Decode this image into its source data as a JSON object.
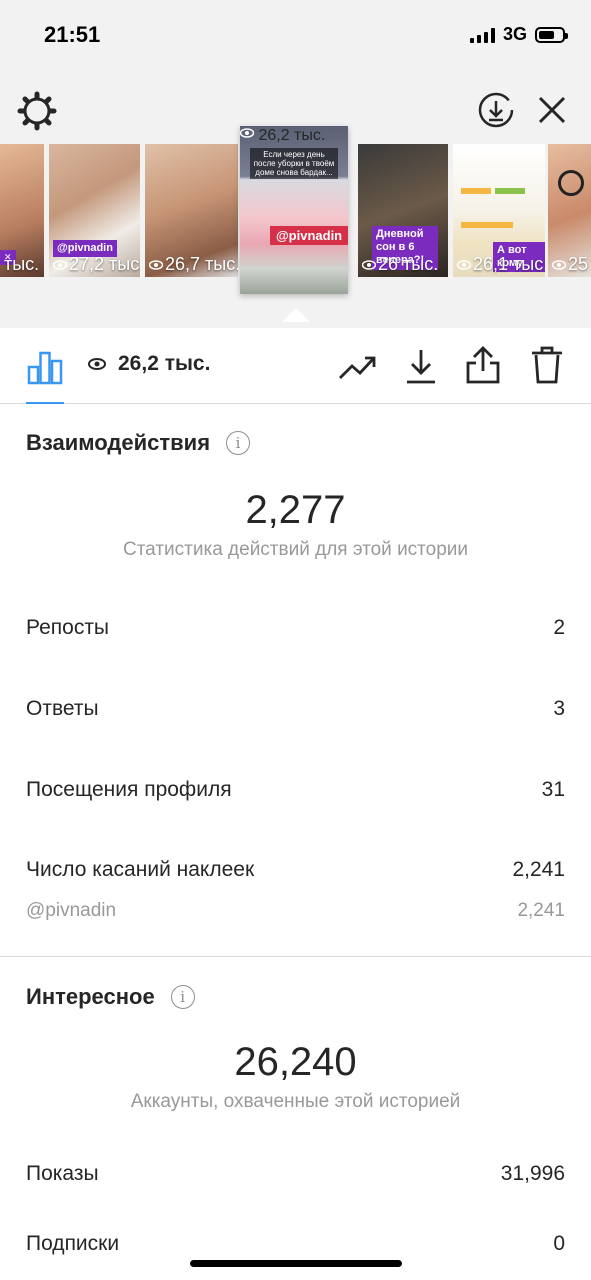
{
  "status_bar": {
    "time": "21:51",
    "network": "3G"
  },
  "thumbnails": [
    {
      "views": "тыс."
    },
    {
      "views": "27,2 тыс."
    },
    {
      "views": "26,7 тыс."
    },
    {
      "views": "26,2 тыс.",
      "active": true,
      "caption": "Если через день после уборки в твоём доме снова бардак...",
      "tag": "@pivnadin"
    },
    {
      "views": "26 тыс.",
      "purple": "Дневной сон в 6 вечера?!"
    },
    {
      "views": "26,1 тыс.",
      "purple": "А вот кому"
    },
    {
      "views": "25"
    }
  ],
  "thumb_extras": {
    "purple_2": "@pivnadin"
  },
  "toolbar": {
    "views": "26,2 тыс."
  },
  "interactions": {
    "title": "Взаимодействия",
    "total": "2,277",
    "subtitle": "Статистика действий для этой истории",
    "rows": [
      {
        "label": "Репосты",
        "value": "2"
      },
      {
        "label": "Ответы",
        "value": "3"
      },
      {
        "label": "Посещения профиля",
        "value": "31"
      },
      {
        "label": "Число касаний наклеек",
        "value": "2,241"
      }
    ],
    "sticker": {
      "label": "@pivnadin",
      "value": "2,241"
    }
  },
  "discovery": {
    "title": "Интересное",
    "total": "26,240",
    "subtitle": "Аккаунты, охваченные этой историей",
    "rows": [
      {
        "label": "Показы",
        "value": "31,996"
      },
      {
        "label": "Подписки",
        "value": "0"
      }
    ]
  },
  "colors": {
    "accent": "#3897f0",
    "muted": "#999999",
    "text": "#262626",
    "tag_red": "#d63049",
    "tag_purple": "#7b2cbf"
  }
}
